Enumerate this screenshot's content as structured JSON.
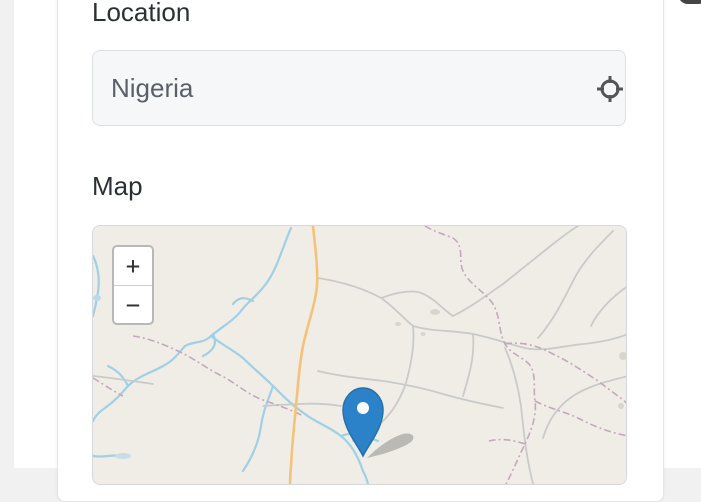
{
  "location": {
    "label": "Location",
    "value": "Nigeria",
    "locate_icon": "crosshair-icon"
  },
  "map": {
    "label": "Map",
    "zoom_in_label": "+",
    "zoom_out_label": "−",
    "marker_icon": "map-pin-icon"
  },
  "colors": {
    "map_background": "#efede6",
    "river": "#9fd0e6",
    "border_line": "#c4a8bd",
    "road": "#c7c7c7",
    "major_road": "#f5c27a",
    "marker": "#2c82c9"
  }
}
